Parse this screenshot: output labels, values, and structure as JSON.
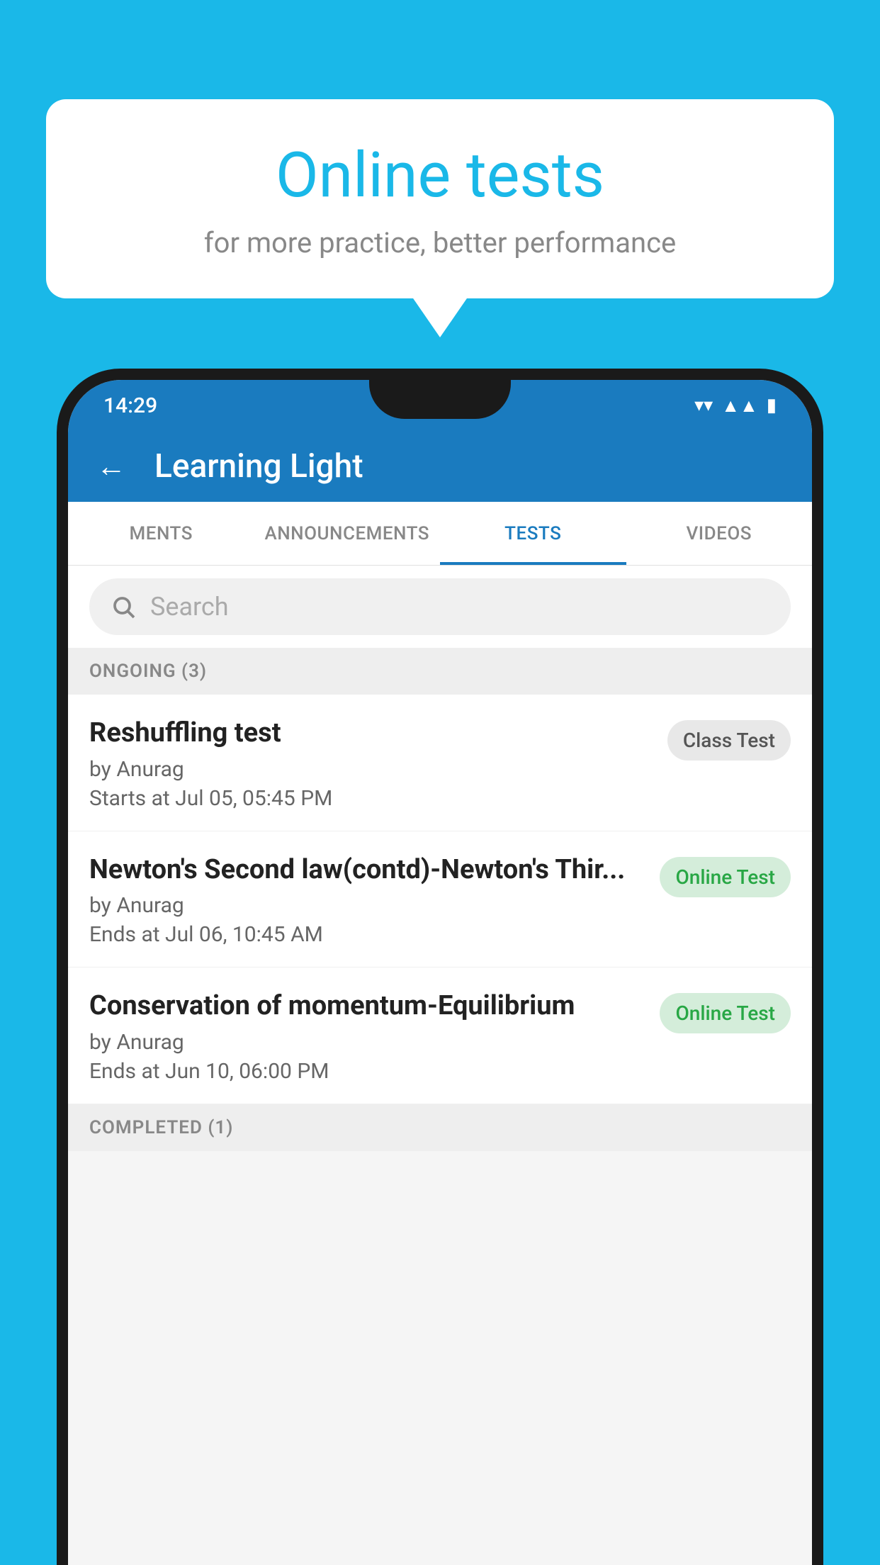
{
  "background_color": "#1ab8e8",
  "bubble": {
    "title": "Online tests",
    "subtitle": "for more practice, better performance"
  },
  "phone": {
    "status_bar": {
      "time": "14:29"
    },
    "header": {
      "title": "Learning Light",
      "back_label": "←"
    },
    "tabs": [
      {
        "label": "MENTS",
        "active": false
      },
      {
        "label": "ANNOUNCEMENTS",
        "active": false
      },
      {
        "label": "TESTS",
        "active": true
      },
      {
        "label": "VIDEOS",
        "active": false
      }
    ],
    "search": {
      "placeholder": "Search"
    },
    "ongoing_section": {
      "label": "ONGOING (3)"
    },
    "tests": [
      {
        "name": "Reshuffling test",
        "author": "by Anurag",
        "time_label": "Starts at  Jul 05, 05:45 PM",
        "badge": "Class Test",
        "badge_type": "class"
      },
      {
        "name": "Newton's Second law(contd)-Newton's Thir...",
        "author": "by Anurag",
        "time_label": "Ends at  Jul 06, 10:45 AM",
        "badge": "Online Test",
        "badge_type": "online"
      },
      {
        "name": "Conservation of momentum-Equilibrium",
        "author": "by Anurag",
        "time_label": "Ends at  Jun 10, 06:00 PM",
        "badge": "Online Test",
        "badge_type": "online"
      }
    ],
    "completed_section": {
      "label": "COMPLETED (1)"
    }
  }
}
